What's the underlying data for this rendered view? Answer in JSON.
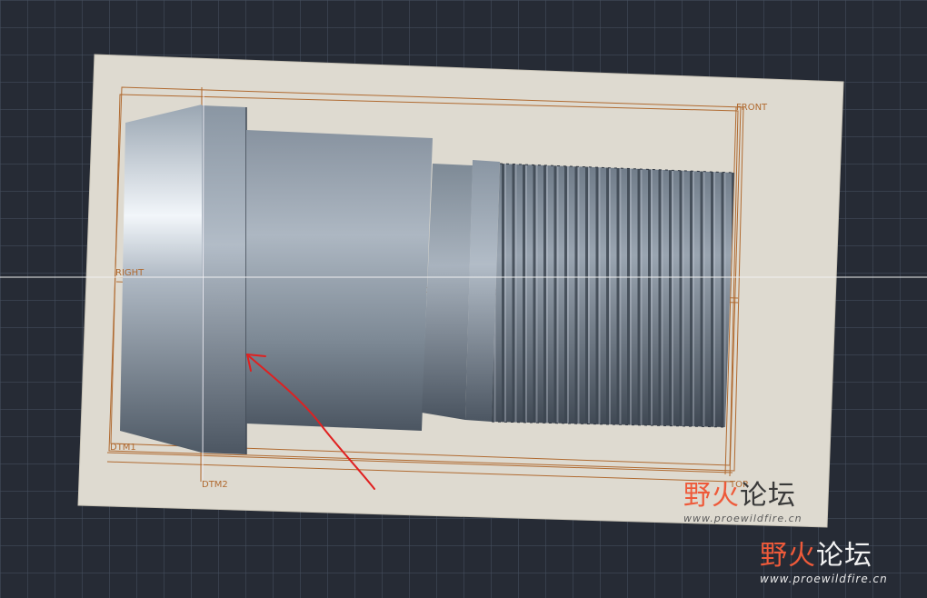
{
  "viewport": {
    "background_color": "#262b35",
    "plane_color": "#dedad0",
    "datum_color": "#b06a30",
    "annotation_color": "#e02020"
  },
  "datums": {
    "front": "FRONT",
    "right": "RIGHT",
    "dtm1": "DTM1",
    "dtm2": "DTM2",
    "top": "TOP"
  },
  "watermarks": [
    {
      "brand_part1": "野火",
      "brand_part2": "论坛",
      "url": "www.proewildfire.cn"
    },
    {
      "brand_part1": "野火",
      "brand_part2": "论坛",
      "url": "www.proewildfire.cn"
    }
  ],
  "icons": {
    "annotation": "red-arrow-icon",
    "logo_flame": "flame-logo-icon"
  }
}
